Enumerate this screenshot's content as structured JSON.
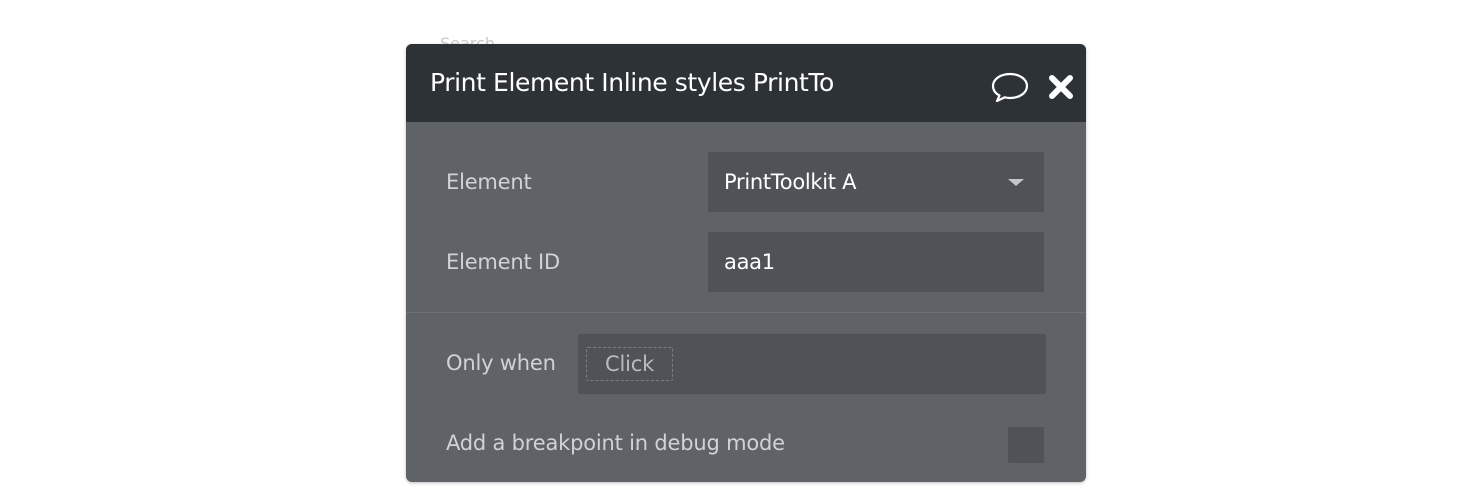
{
  "background": {
    "peek_text": "Search"
  },
  "panel": {
    "title": "Print Element Inline styles PrintTo",
    "header_icons": {
      "comment": "comment-icon",
      "close": "close-icon"
    },
    "fields": {
      "element": {
        "label": "Element",
        "value": "PrintToolkit A"
      },
      "element_id": {
        "label": "Element ID",
        "value": "aaa1"
      },
      "only_when": {
        "label": "Only when",
        "token": "Click"
      },
      "breakpoint": {
        "label": "Add a breakpoint in debug mode",
        "checked": false
      }
    }
  },
  "colors": {
    "header": "#2c3236",
    "panel": "#5f6367",
    "field": "#4f5357",
    "label": "#d0d3d5",
    "value": "#ffffff"
  }
}
